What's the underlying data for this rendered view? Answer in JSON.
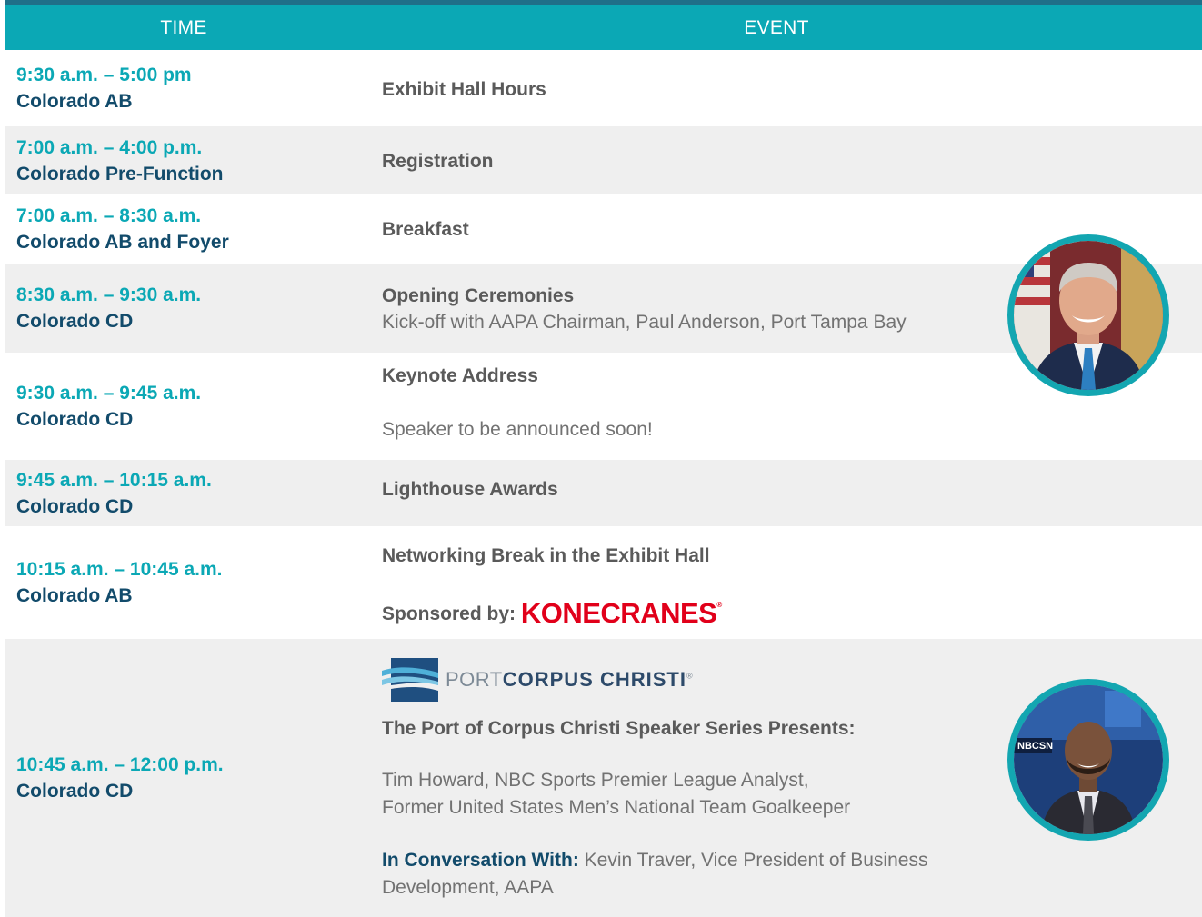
{
  "header": {
    "time_label": "TIME",
    "event_label": "EVENT"
  },
  "rows": [
    {
      "time": "9:30 a.m. – 5:00 pm",
      "location": "Colorado AB",
      "title": "Exhibit Hall Hours"
    },
    {
      "time": "7:00 a.m. – 4:00 p.m.",
      "location": "Colorado Pre-Function",
      "title": "Registration"
    },
    {
      "time": "7:00 a.m. – 8:30 a.m.",
      "location": "Colorado AB and Foyer",
      "title": "Breakfast"
    },
    {
      "time": "8:30 a.m. – 9:30 a.m.",
      "location": "Colorado CD",
      "title": "Opening Ceremonies",
      "detail": "Kick-off with AAPA Chairman, Paul Anderson, Port Tampa Bay"
    },
    {
      "time": "9:30 a.m. – 9:45 a.m.",
      "location": "Colorado CD",
      "title": "Keynote Address",
      "detail": "Speaker to be announced soon!"
    },
    {
      "time": "9:45 a.m. – 10:15 a.m.",
      "location": "Colorado CD",
      "title": "Lighthouse Awards"
    },
    {
      "time": "10:15 a.m. – 10:45 a.m.",
      "location": "Colorado AB",
      "title": "Networking Break in the Exhibit Hall",
      "sponsor_label": "Sponsored by:",
      "sponsor_logo": "KONECRANES"
    },
    {
      "time": "10:45 a.m. – 12:00 p.m.",
      "location": "Colorado CD",
      "logo_text_light": "PORT",
      "logo_text_bold": "CORPUS CHRISTI",
      "logo_mark": "®",
      "title": "The Port of Corpus Christi Speaker Series Presents:",
      "detail_line1": "Tim Howard, NBC Sports Premier League Analyst,",
      "detail_line2": "Former United States Men’s National Team Goalkeeper",
      "conv_label": "In Conversation With:",
      "conv_text1": " Kevin Traver, Vice President of Business",
      "conv_text2": "Development, AAPA"
    }
  ],
  "colors": {
    "header_bg": "#0ba8b5",
    "top_bar": "#1f6f89",
    "time_teal": "#0ba8b5",
    "location_navy": "#124b6b",
    "row_alt_bg": "#efefef",
    "sponsor_red": "#e1001a",
    "photo_ring": "#13a6b1"
  },
  "images": {
    "photo1": "portrait-man-suit-flags",
    "photo2": "portrait-man-nbcsn-studio",
    "pcc_logo": "wave-flag-logo-icon"
  }
}
